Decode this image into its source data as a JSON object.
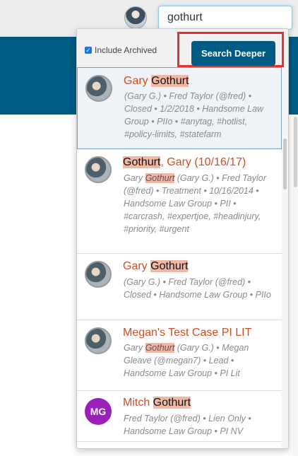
{
  "search": {
    "value": "gothurt"
  },
  "header": {
    "include_archived_label": "Include Archived",
    "search_deeper_label": "Search Deeper"
  },
  "results": [
    {
      "title_pre": "Gary ",
      "title_hl": "Gothurt",
      "title_post": "",
      "meta_pre": "(Gary G.) • Fred Taylor (@fred) • Closed • 1/2/2018 • Handsome Law Group • PIIo • #anytag, #hotlist, #policy-limits, #statefarm",
      "meta_hl": "",
      "meta_post": ""
    },
    {
      "title_pre": "",
      "title_hl": "Gothurt",
      "title_post": ", Gary (10/16/17)",
      "meta_pre": "Gary ",
      "meta_hl": "Gothurt",
      "meta_post": " (Gary G.) • Fred Taylor (@fred) • Treatment • 10/16/2014 • Handsome Law Group • PII • #carcrash, #expertjoe, #headinjury, #priority, #urgent"
    },
    {
      "title_pre": "Gary ",
      "title_hl": "Gothurt",
      "title_post": "",
      "meta_pre": "(Gary G.) • Fred Taylor (@fred) • Closed • Handsome Law Group • PIIo",
      "meta_hl": "",
      "meta_post": ""
    },
    {
      "title_pre": "Megan's Test Case PI LIT",
      "title_hl": "",
      "title_post": "",
      "meta_pre": "Gary ",
      "meta_hl": "Gothurt",
      "meta_post": " (Gary G.) • Megan Gleave (@megan7) • Lead • Handsome Law Group • PI Lit"
    },
    {
      "avatar_initials": "MG",
      "title_pre": "Mitch ",
      "title_hl": "Gothurt",
      "title_post": "",
      "meta_pre": "Fred Taylor (@fred) • Lien Only • Handsome Law Group • PI NV",
      "meta_hl": "",
      "meta_post": ""
    }
  ],
  "colors": {
    "accent": "#005b82",
    "highlight": "#f2b7a4",
    "title": "#d14d1c",
    "callout": "#e5322d",
    "mg_avatar": "#9b1fb8"
  },
  "icons": {
    "top_avatar": "user-avatar",
    "checkbox": "checkbox-checked-icon"
  }
}
